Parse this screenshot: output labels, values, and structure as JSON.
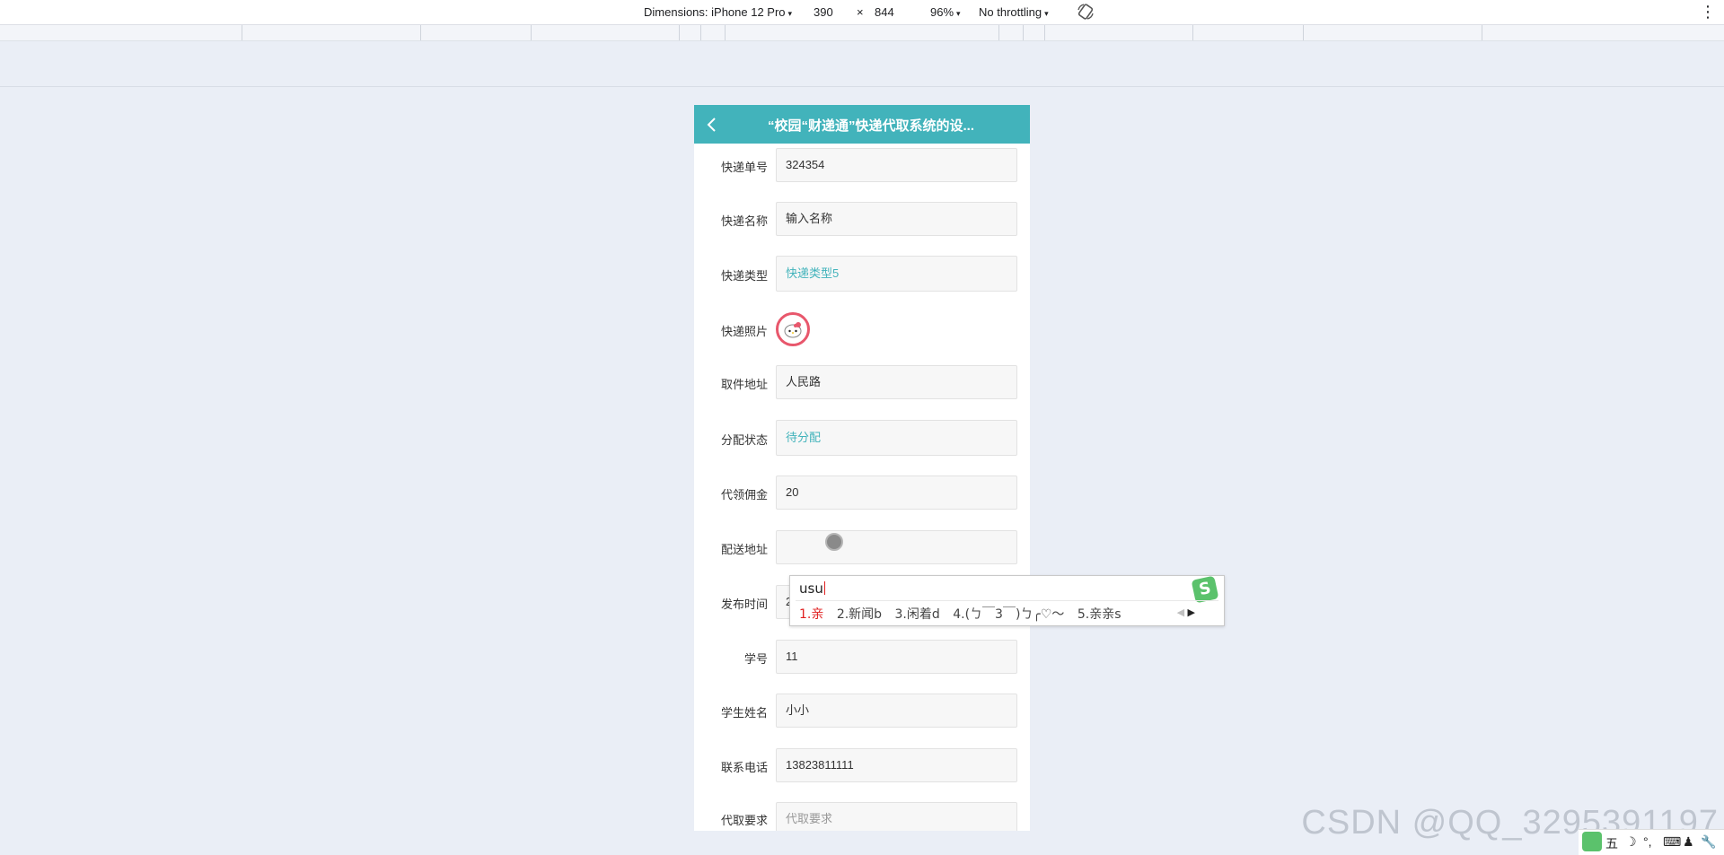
{
  "devtools": {
    "dimensions_label": "Dimensions: iPhone 12 Pro",
    "width": "390",
    "times": "×",
    "height": "844",
    "zoom": "96%",
    "throttling": "No throttling",
    "caret": "▾",
    "rotate_icon": "rotate-icon",
    "menu_icon": "⋮"
  },
  "page": {
    "title": "“校园“财递通”快递代取系统的设...",
    "back_icon": "chevron-left-icon",
    "accent": "#42b3bb",
    "fields": [
      {
        "label": "快递单号",
        "value": "324354"
      },
      {
        "label": "快递名称",
        "value": "输入名称"
      },
      {
        "label": "快递类型",
        "value": "快递类型5"
      },
      {
        "label": "快递照片",
        "value": ""
      },
      {
        "label": "取件地址",
        "value": "人民路"
      },
      {
        "label": "分配状态",
        "value": "待分配"
      },
      {
        "label": "代领佣金",
        "value": "20"
      },
      {
        "label": "配送地址",
        "value": ""
      },
      {
        "label": "发布时间",
        "value": "2"
      },
      {
        "label": "学号",
        "value": "11"
      },
      {
        "label": "学生姓名",
        "value": "小小"
      },
      {
        "label": "联系电话",
        "value": "13823811111"
      },
      {
        "label": "代取要求",
        "placeholder": "代取要求"
      }
    ]
  },
  "ime": {
    "input": "usu",
    "logo": "S",
    "candidates": [
      "1.亲",
      "2.新闻b",
      "3.闲着d",
      "4.(ㄅ￣3￣)ㄅ╭♡～",
      "5.亲亲s"
    ],
    "prev_arrow": "◀",
    "next_arrow": "▶"
  },
  "watermark": "CSDN @QQ_3295391197",
  "tray": {
    "wu": "五",
    "moon": "☽",
    "dots": "°,",
    "keyboard": "⌨",
    "person": "♟",
    "wrench": "🔧"
  }
}
